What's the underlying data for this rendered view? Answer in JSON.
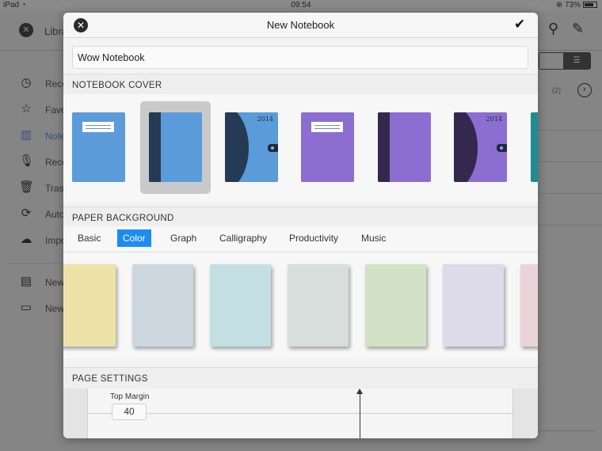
{
  "status_bar": {
    "device": "iPad",
    "time": "09:54",
    "battery": "73%"
  },
  "background": {
    "title": "Libra",
    "sidebar": [
      {
        "label": "Rece",
        "icon": "clock-icon"
      },
      {
        "label": "Favo",
        "icon": "star-icon"
      },
      {
        "label": "Note",
        "icon": "notebooks-icon",
        "active": true
      },
      {
        "label": "Reco",
        "icon": "microphone-icon"
      },
      {
        "label": "Trasl",
        "icon": "trash-icon"
      },
      {
        "label": "Auto",
        "icon": "sync-icon"
      },
      {
        "label": "Impo",
        "icon": "cloud-download-icon"
      }
    ],
    "sidebar_actions": [
      {
        "label": "New",
        "icon": "new-notebook-icon"
      },
      {
        "label": "New",
        "icon": "new-folder-icon"
      }
    ],
    "count": "(2)"
  },
  "modal": {
    "title": "New Notebook",
    "name_value": "Wow Notebook",
    "sections": {
      "cover": "NOTEBOOK COVER",
      "paper": "PAPER BACKGROUND",
      "page": "PAGE SETTINGS"
    },
    "covers": [
      {
        "style": "label",
        "color": "#5b9bd9",
        "selected": false
      },
      {
        "style": "spine",
        "color": "#5b9bd9",
        "selected": true
      },
      {
        "style": "curve",
        "color": "#5b9bd9",
        "year": "2014",
        "selected": false
      },
      {
        "style": "label",
        "color": "#8c6dd0",
        "selected": false
      },
      {
        "style": "spine",
        "color": "#8c6dd0",
        "selected": false
      },
      {
        "style": "curve",
        "color": "#8c6dd0",
        "year": "2014",
        "selected": false
      },
      {
        "style": "plain",
        "color": "#1c8e94",
        "selected": false
      }
    ],
    "paper_tabs": [
      "Basic",
      "Color",
      "Graph",
      "Calligraphy",
      "Productivity",
      "Music"
    ],
    "active_tab": "Color",
    "papers": [
      "#ede3a8",
      "#cdd7df",
      "#c3dfe3",
      "#d8dedb",
      "#d1e2c7",
      "#dddae9",
      "#ebd3da"
    ],
    "page_settings": {
      "top_margin_label": "Top Margin",
      "top_margin_value": "40"
    }
  }
}
